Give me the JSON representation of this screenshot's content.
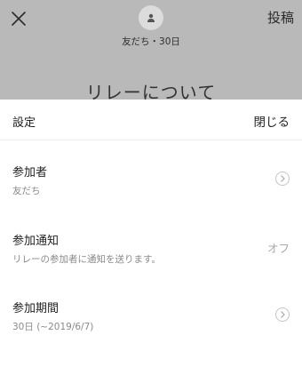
{
  "background": {
    "post_label": "投稿",
    "audience": "友だち・30日",
    "title": "リレーについて"
  },
  "sheet": {
    "title": "設定",
    "close_label": "閉じる",
    "rows": [
      {
        "label": "参加者",
        "sub": "友だち"
      },
      {
        "label": "参加通知",
        "sub": "リレーの参加者に通知を送ります。",
        "value": "オフ"
      },
      {
        "label": "参加期間",
        "sub": "30日 (~2019/6/7)"
      }
    ]
  },
  "icons": {
    "close": "close-icon",
    "avatar": "person-icon",
    "chevron": "chevron-right-icon"
  }
}
